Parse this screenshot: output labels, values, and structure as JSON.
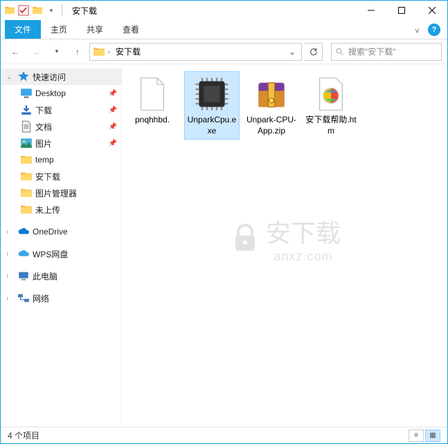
{
  "title": "安下载",
  "ribbon": {
    "file": "文件",
    "home": "主页",
    "share": "共享",
    "view": "查看"
  },
  "nav": {
    "crumb": "安下载",
    "search_placeholder": "搜索\"安下载\""
  },
  "sidebar": {
    "quick": {
      "label": "快速访问",
      "items": [
        {
          "label": "Desktop",
          "icon": "desktop",
          "pinned": true
        },
        {
          "label": "下载",
          "icon": "downloads",
          "pinned": true
        },
        {
          "label": "文档",
          "icon": "documents",
          "pinned": true
        },
        {
          "label": "图片",
          "icon": "pictures",
          "pinned": true
        },
        {
          "label": "temp",
          "icon": "folder",
          "pinned": false
        },
        {
          "label": "安下载",
          "icon": "folder",
          "pinned": false
        },
        {
          "label": "图片管理器",
          "icon": "folder",
          "pinned": false
        },
        {
          "label": "未上传",
          "icon": "folder",
          "pinned": false
        }
      ]
    },
    "onedrive": "OneDrive",
    "wps": "WPS网盘",
    "thispc": "此电脑",
    "network": "网络"
  },
  "files": [
    {
      "name": "pnqhhbd.",
      "type": "blank",
      "selected": false
    },
    {
      "name": "UnparkCpu.exe",
      "type": "cpu",
      "selected": true
    },
    {
      "name": "Unpark-CPU-App.zip",
      "type": "zip",
      "selected": false
    },
    {
      "name": "安下载帮助.htm",
      "type": "htm",
      "selected": false
    }
  ],
  "status": {
    "count": "4 个项目"
  },
  "watermark": {
    "text": "安下载",
    "domain": "anxz.com"
  }
}
